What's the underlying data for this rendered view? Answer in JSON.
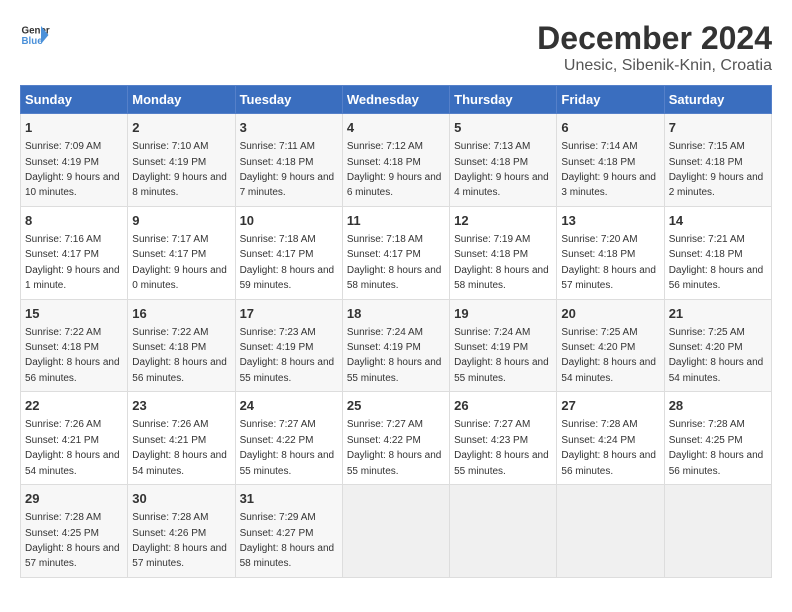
{
  "header": {
    "logo_general": "General",
    "logo_blue": "Blue",
    "title": "December 2024",
    "subtitle": "Unesic, Sibenik-Knin, Croatia"
  },
  "calendar": {
    "days_of_week": [
      "Sunday",
      "Monday",
      "Tuesday",
      "Wednesday",
      "Thursday",
      "Friday",
      "Saturday"
    ],
    "weeks": [
      [
        {
          "day": "1",
          "sunrise": "Sunrise: 7:09 AM",
          "sunset": "Sunset: 4:19 PM",
          "daylight": "Daylight: 9 hours and 10 minutes."
        },
        {
          "day": "2",
          "sunrise": "Sunrise: 7:10 AM",
          "sunset": "Sunset: 4:19 PM",
          "daylight": "Daylight: 9 hours and 8 minutes."
        },
        {
          "day": "3",
          "sunrise": "Sunrise: 7:11 AM",
          "sunset": "Sunset: 4:18 PM",
          "daylight": "Daylight: 9 hours and 7 minutes."
        },
        {
          "day": "4",
          "sunrise": "Sunrise: 7:12 AM",
          "sunset": "Sunset: 4:18 PM",
          "daylight": "Daylight: 9 hours and 6 minutes."
        },
        {
          "day": "5",
          "sunrise": "Sunrise: 7:13 AM",
          "sunset": "Sunset: 4:18 PM",
          "daylight": "Daylight: 9 hours and 4 minutes."
        },
        {
          "day": "6",
          "sunrise": "Sunrise: 7:14 AM",
          "sunset": "Sunset: 4:18 PM",
          "daylight": "Daylight: 9 hours and 3 minutes."
        },
        {
          "day": "7",
          "sunrise": "Sunrise: 7:15 AM",
          "sunset": "Sunset: 4:18 PM",
          "daylight": "Daylight: 9 hours and 2 minutes."
        }
      ],
      [
        {
          "day": "8",
          "sunrise": "Sunrise: 7:16 AM",
          "sunset": "Sunset: 4:17 PM",
          "daylight": "Daylight: 9 hours and 1 minute."
        },
        {
          "day": "9",
          "sunrise": "Sunrise: 7:17 AM",
          "sunset": "Sunset: 4:17 PM",
          "daylight": "Daylight: 9 hours and 0 minutes."
        },
        {
          "day": "10",
          "sunrise": "Sunrise: 7:18 AM",
          "sunset": "Sunset: 4:17 PM",
          "daylight": "Daylight: 8 hours and 59 minutes."
        },
        {
          "day": "11",
          "sunrise": "Sunrise: 7:18 AM",
          "sunset": "Sunset: 4:17 PM",
          "daylight": "Daylight: 8 hours and 58 minutes."
        },
        {
          "day": "12",
          "sunrise": "Sunrise: 7:19 AM",
          "sunset": "Sunset: 4:18 PM",
          "daylight": "Daylight: 8 hours and 58 minutes."
        },
        {
          "day": "13",
          "sunrise": "Sunrise: 7:20 AM",
          "sunset": "Sunset: 4:18 PM",
          "daylight": "Daylight: 8 hours and 57 minutes."
        },
        {
          "day": "14",
          "sunrise": "Sunrise: 7:21 AM",
          "sunset": "Sunset: 4:18 PM",
          "daylight": "Daylight: 8 hours and 56 minutes."
        }
      ],
      [
        {
          "day": "15",
          "sunrise": "Sunrise: 7:22 AM",
          "sunset": "Sunset: 4:18 PM",
          "daylight": "Daylight: 8 hours and 56 minutes."
        },
        {
          "day": "16",
          "sunrise": "Sunrise: 7:22 AM",
          "sunset": "Sunset: 4:18 PM",
          "daylight": "Daylight: 8 hours and 56 minutes."
        },
        {
          "day": "17",
          "sunrise": "Sunrise: 7:23 AM",
          "sunset": "Sunset: 4:19 PM",
          "daylight": "Daylight: 8 hours and 55 minutes."
        },
        {
          "day": "18",
          "sunrise": "Sunrise: 7:24 AM",
          "sunset": "Sunset: 4:19 PM",
          "daylight": "Daylight: 8 hours and 55 minutes."
        },
        {
          "day": "19",
          "sunrise": "Sunrise: 7:24 AM",
          "sunset": "Sunset: 4:19 PM",
          "daylight": "Daylight: 8 hours and 55 minutes."
        },
        {
          "day": "20",
          "sunrise": "Sunrise: 7:25 AM",
          "sunset": "Sunset: 4:20 PM",
          "daylight": "Daylight: 8 hours and 54 minutes."
        },
        {
          "day": "21",
          "sunrise": "Sunrise: 7:25 AM",
          "sunset": "Sunset: 4:20 PM",
          "daylight": "Daylight: 8 hours and 54 minutes."
        }
      ],
      [
        {
          "day": "22",
          "sunrise": "Sunrise: 7:26 AM",
          "sunset": "Sunset: 4:21 PM",
          "daylight": "Daylight: 8 hours and 54 minutes."
        },
        {
          "day": "23",
          "sunrise": "Sunrise: 7:26 AM",
          "sunset": "Sunset: 4:21 PM",
          "daylight": "Daylight: 8 hours and 54 minutes."
        },
        {
          "day": "24",
          "sunrise": "Sunrise: 7:27 AM",
          "sunset": "Sunset: 4:22 PM",
          "daylight": "Daylight: 8 hours and 55 minutes."
        },
        {
          "day": "25",
          "sunrise": "Sunrise: 7:27 AM",
          "sunset": "Sunset: 4:22 PM",
          "daylight": "Daylight: 8 hours and 55 minutes."
        },
        {
          "day": "26",
          "sunrise": "Sunrise: 7:27 AM",
          "sunset": "Sunset: 4:23 PM",
          "daylight": "Daylight: 8 hours and 55 minutes."
        },
        {
          "day": "27",
          "sunrise": "Sunrise: 7:28 AM",
          "sunset": "Sunset: 4:24 PM",
          "daylight": "Daylight: 8 hours and 56 minutes."
        },
        {
          "day": "28",
          "sunrise": "Sunrise: 7:28 AM",
          "sunset": "Sunset: 4:25 PM",
          "daylight": "Daylight: 8 hours and 56 minutes."
        }
      ],
      [
        {
          "day": "29",
          "sunrise": "Sunrise: 7:28 AM",
          "sunset": "Sunset: 4:25 PM",
          "daylight": "Daylight: 8 hours and 57 minutes."
        },
        {
          "day": "30",
          "sunrise": "Sunrise: 7:28 AM",
          "sunset": "Sunset: 4:26 PM",
          "daylight": "Daylight: 8 hours and 57 minutes."
        },
        {
          "day": "31",
          "sunrise": "Sunrise: 7:29 AM",
          "sunset": "Sunset: 4:27 PM",
          "daylight": "Daylight: 8 hours and 58 minutes."
        },
        null,
        null,
        null,
        null
      ]
    ]
  }
}
